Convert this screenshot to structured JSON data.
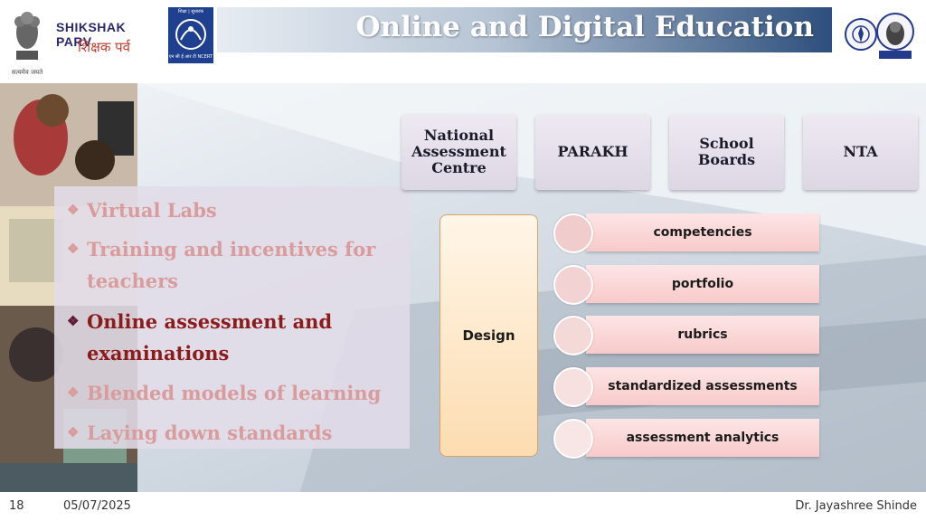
{
  "header": {
    "title": "Online and Digital Education",
    "emblem_caption": "सत्यमेव जयते",
    "logo_en": "SHIKSHAK PARV",
    "logo_hi": "शिक्षक पर्व",
    "ncert_top": "शिक्षा | सुधारक",
    "ncert_bottom": "एन सी ई आर टी NCERT"
  },
  "bullets": [
    {
      "text": "Virtual Labs",
      "state": "faded"
    },
    {
      "text": "Training and incentives for teachers",
      "state": "faded"
    },
    {
      "text": "Online assessment and examinations",
      "state": "active"
    },
    {
      "text": "Blended models of learning",
      "state": "faded"
    },
    {
      "text": "Laying down standards",
      "state": "faded"
    }
  ],
  "orgs": [
    "National Assessment Centre",
    "PARAKH",
    "School Boards",
    "NTA"
  ],
  "design_label": "Design",
  "design_items": [
    {
      "label": "competencies",
      "circle_color": "#f0cccc"
    },
    {
      "label": "portfolio",
      "circle_color": "#f2d2d2"
    },
    {
      "label": "rubrics",
      "circle_color": "#f4d9d9"
    },
    {
      "label": "standardized assessments",
      "circle_color": "#f6e0e0"
    },
    {
      "label": "assessment analytics",
      "circle_color": "#f8e6e6"
    }
  ],
  "footer": {
    "slide_number": "18",
    "date": "05/07/2025",
    "author": "Dr. Jayashree Shinde"
  },
  "colors": {
    "active_bullet": "#8b1c1c",
    "faded_bullet": "#d99c9c"
  }
}
